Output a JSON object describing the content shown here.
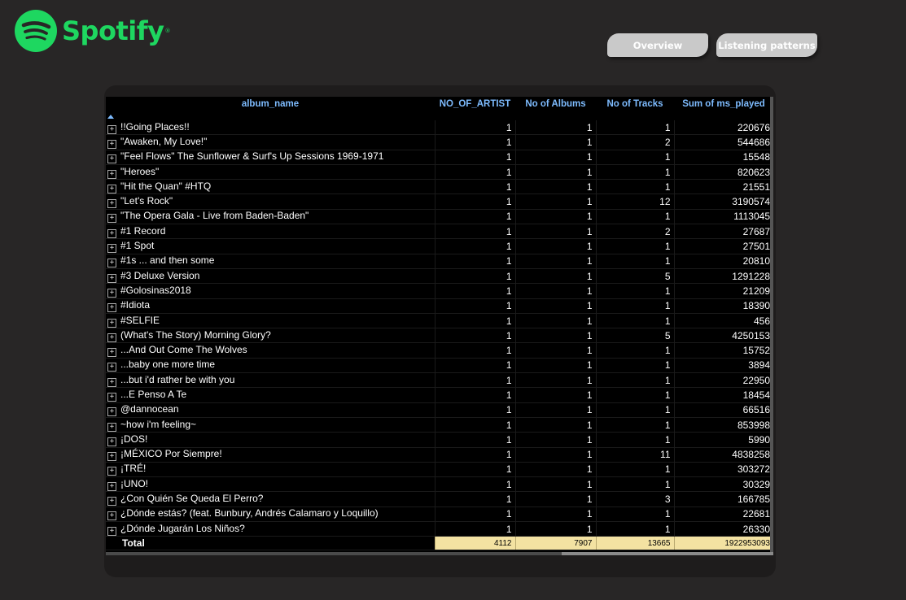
{
  "brand": {
    "name": "Spotify",
    "color": "#1ED760",
    "icon": "spotify-logo-icon"
  },
  "nav": {
    "overview_label": "Overview",
    "listening_label": "Listening patterns"
  },
  "table": {
    "columns": [
      "album_name",
      "NO_OF_ARTIST",
      "No of Albums",
      "No of Tracks",
      "Sum of ms_played"
    ],
    "rows": [
      [
        "!!Going Places!!",
        "1",
        "1",
        "1",
        "220676"
      ],
      [
        "\"Awaken, My Love!\"",
        "1",
        "1",
        "2",
        "544686"
      ],
      [
        "\"Feel Flows\" The Sunflower & Surf's Up Sessions 1969-1971",
        "1",
        "1",
        "1",
        "15548"
      ],
      [
        "\"Heroes\"",
        "1",
        "1",
        "1",
        "820623"
      ],
      [
        "\"Hit the Quan\" #HTQ",
        "1",
        "1",
        "1",
        "21551"
      ],
      [
        "\"Let's Rock\"",
        "1",
        "1",
        "12",
        "3190574"
      ],
      [
        "\"The Opera Gala - Live from Baden-Baden\"",
        "1",
        "1",
        "1",
        "1113045"
      ],
      [
        "#1 Record",
        "1",
        "1",
        "2",
        "27687"
      ],
      [
        "#1 Spot",
        "1",
        "1",
        "1",
        "27501"
      ],
      [
        "#1s ... and then some",
        "1",
        "1",
        "1",
        "20810"
      ],
      [
        "#3 Deluxe Version",
        "1",
        "1",
        "5",
        "1291228"
      ],
      [
        "#Golosinas2018",
        "1",
        "1",
        "1",
        "21209"
      ],
      [
        "#Idiota",
        "1",
        "1",
        "1",
        "18390"
      ],
      [
        "#SELFIE",
        "1",
        "1",
        "1",
        "456"
      ],
      [
        "(What's The Story) Morning Glory?",
        "1",
        "1",
        "5",
        "4250153"
      ],
      [
        "...And Out Come The Wolves",
        "1",
        "1",
        "1",
        "15752"
      ],
      [
        "...baby one more time",
        "1",
        "1",
        "1",
        "3894"
      ],
      [
        "...but i'd rather be with you",
        "1",
        "1",
        "1",
        "22950"
      ],
      [
        "...E Penso A Te",
        "1",
        "1",
        "1",
        "18454"
      ],
      [
        "@dannocean",
        "1",
        "1",
        "1",
        "66516"
      ],
      [
        "~how i'm feeling~",
        "1",
        "1",
        "1",
        "853998"
      ],
      [
        "¡DOS!",
        "1",
        "1",
        "1",
        "5990"
      ],
      [
        "¡MÉXICO Por Siempre!",
        "1",
        "1",
        "11",
        "4838258"
      ],
      [
        "¡TRÉ!",
        "1",
        "1",
        "1",
        "303272"
      ],
      [
        "¡UNO!",
        "1",
        "1",
        "1",
        "30329"
      ],
      [
        "¿Con Quién Se Queda El Perro?",
        "1",
        "1",
        "3",
        "166785"
      ],
      [
        "¿Dónde estás? (feat. Bunbury, Andrés Calamaro y Loquillo)",
        "1",
        "1",
        "1",
        "22681"
      ],
      [
        "¿Dónde Jugarán Los Niños?",
        "1",
        "1",
        "1",
        "26330"
      ]
    ],
    "total": {
      "label": "Total",
      "artists": "4112",
      "albums": "7907",
      "tracks": "13665",
      "ms_played": "1922953093"
    }
  }
}
